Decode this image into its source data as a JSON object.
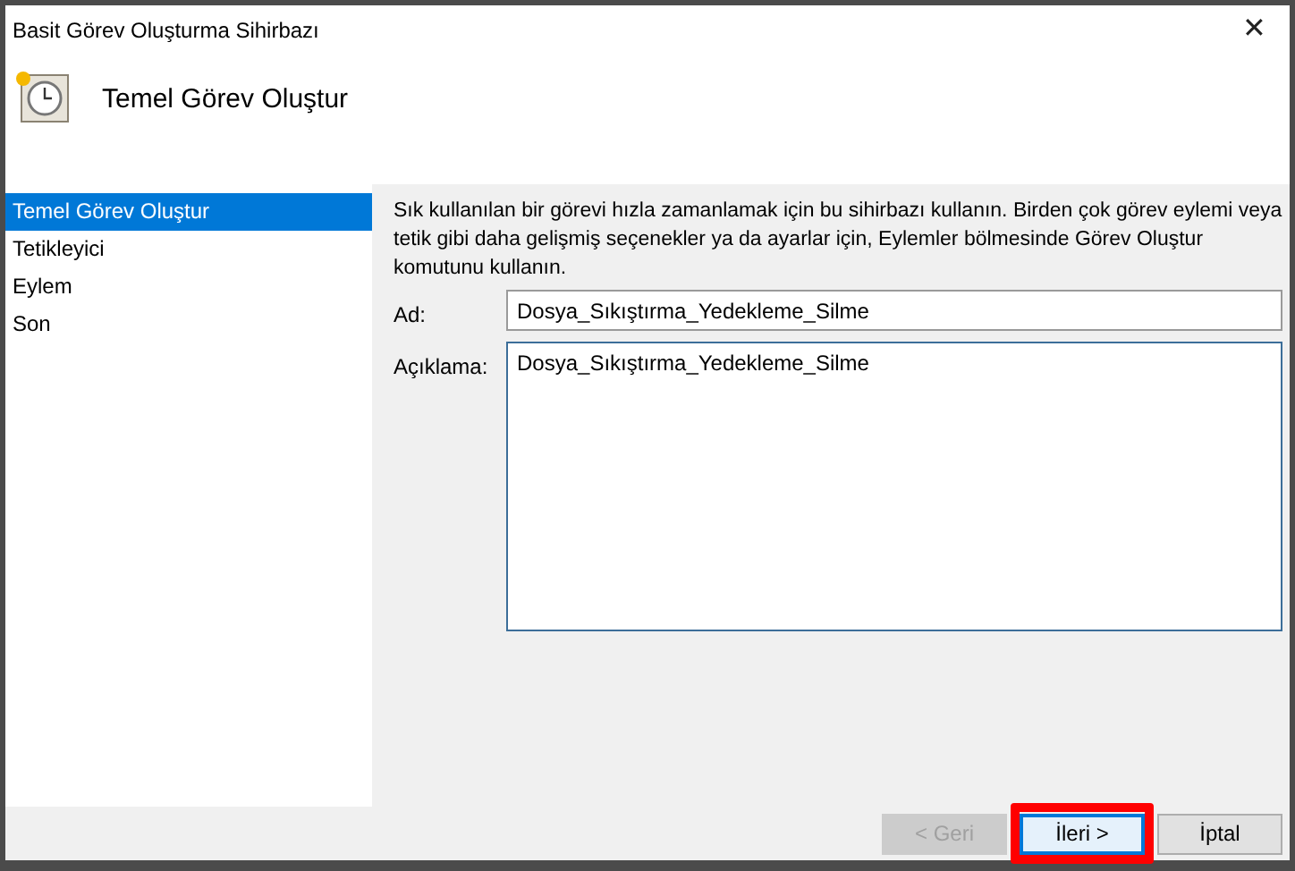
{
  "window": {
    "title": "Basit Görev Oluşturma Sihirbazı",
    "close": "✕"
  },
  "header": {
    "title": "Temel Görev Oluştur"
  },
  "steps": [
    {
      "label": "Temel Görev Oluştur",
      "selected": true
    },
    {
      "label": "Tetikleyici",
      "selected": false
    },
    {
      "label": "Eylem",
      "selected": false
    },
    {
      "label": "Son",
      "selected": false
    }
  ],
  "intro": "Sık kullanılan bir görevi hızla zamanlamak için bu sihirbazı kullanın. Birden çok görev eylemi veya tetik gibi daha gelişmiş seçenekler ya da ayarlar için, Eylemler bölmesinde Görev Oluştur komutunu kullanın.",
  "fields": [
    {
      "label": "Ad:",
      "value": "Dosya_Sıkıştırma_Yedekleme_Silme",
      "kind": "line"
    },
    {
      "label": "Açıklama:",
      "value": "Dosya_Sıkıştırma_Yedekleme_Silme",
      "kind": "area"
    }
  ],
  "buttons": [
    {
      "label": "< Geri",
      "disabled": true,
      "highlighted": false,
      "focused": false
    },
    {
      "label": "İleri >",
      "disabled": false,
      "highlighted": true,
      "focused": true
    },
    {
      "label": "İptal",
      "disabled": false,
      "highlighted": false,
      "focused": false
    }
  ]
}
